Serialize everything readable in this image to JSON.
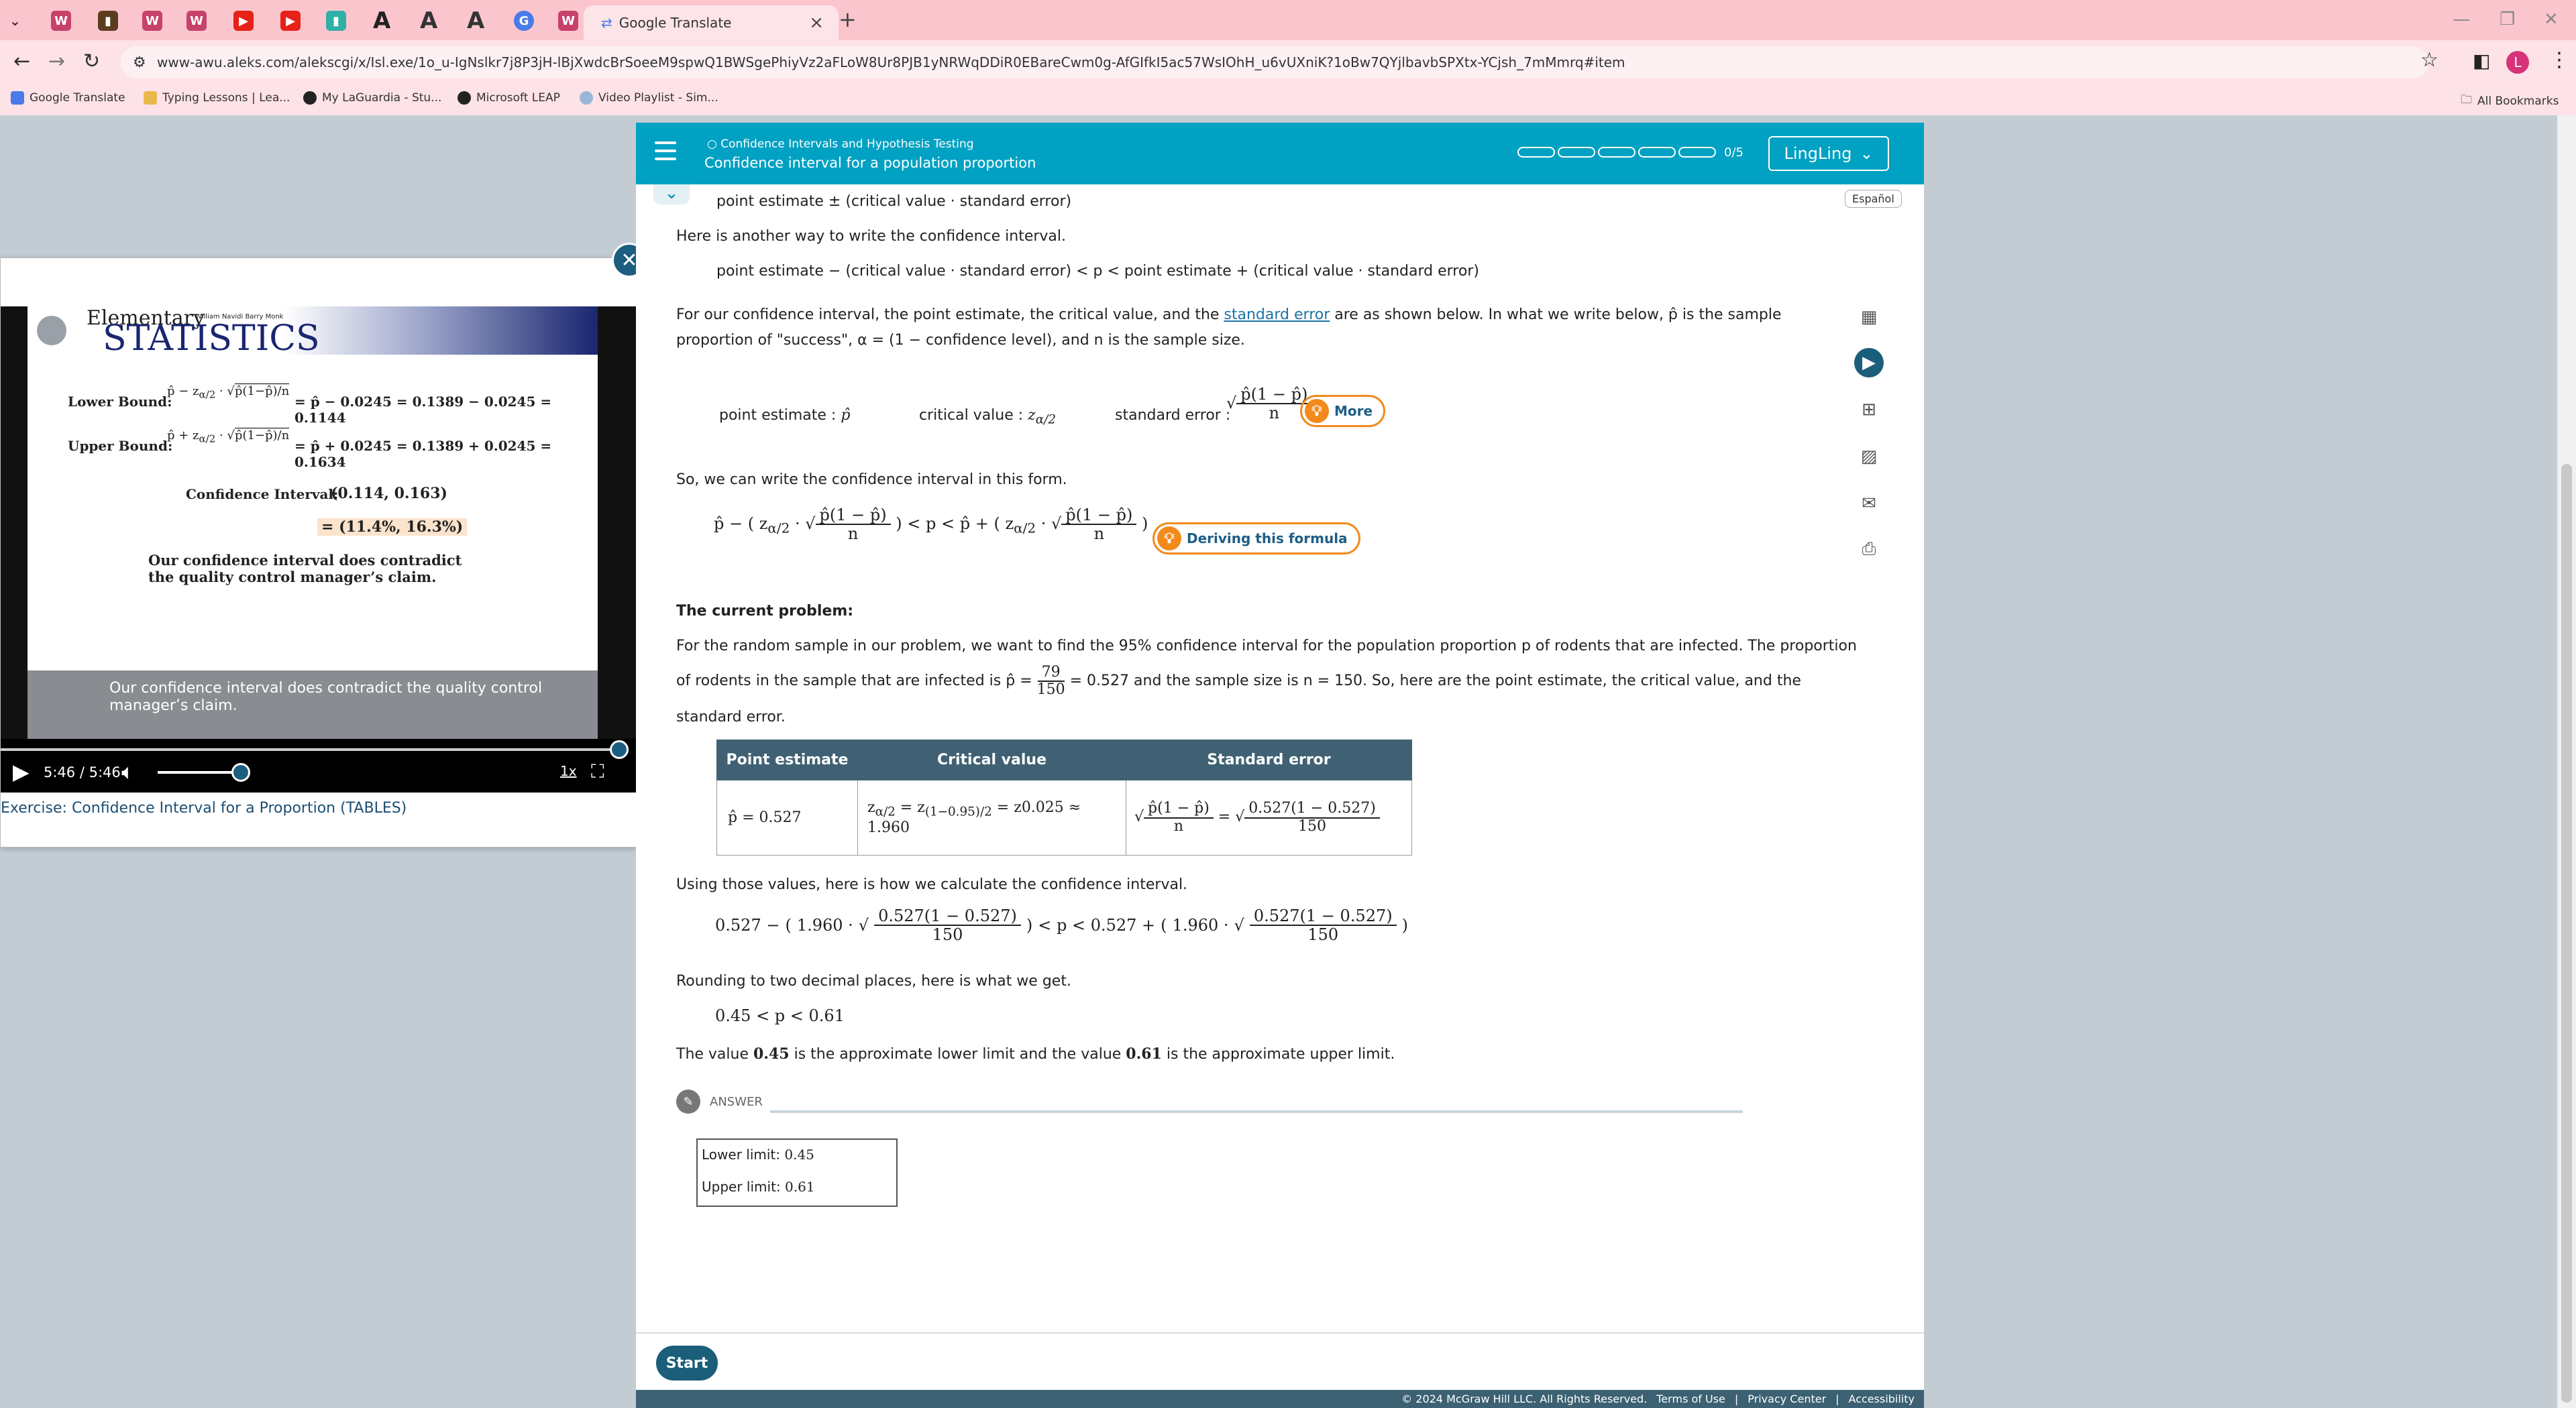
{
  "browser": {
    "active_tab_title": "Google Translate",
    "url": "www-awu.aleks.com/alekscgi/x/Isl.exe/1o_u-IgNslkr7j8P3jH-lBjXwdcBrSoeeM9spwQ1BWSgePhiyVz2aFLoW8Ur8PJB1yNRWqDDiR0EBareCwm0g-AfGIfkI5ac57WsIOhH_u6vUXniK?1oBw7QYjlbavbSPXtx-YCjsh_7mMmrq#item",
    "bookmarks": [
      "Google Translate",
      "Typing Lessons | Lea...",
      "My LaGuardia - Stu...",
      "Microsoft LEAP",
      "Video Playlist - Sim..."
    ],
    "all_bookmarks": "All Bookmarks",
    "profile_initial": "L"
  },
  "video": {
    "slide_title_small": "Elementary",
    "slide_title_big": "STATISTICS",
    "slide_authors": "William Navidi   Barry Monk",
    "lower_bound_label": "Lower Bound:",
    "lower_bound_eq": "= p̂ − 0.0245 = 0.1389 − 0.0245 = 0.1144",
    "upper_bound_label": "Upper Bound:",
    "upper_bound_eq": "= p̂ + 0.0245 = 0.1389 + 0.0245 = 0.1634",
    "ci_label": "Confidence Interval:",
    "ci_value": "(0.114, 0.163)",
    "ci_percent": "= (11.4%, 16.3%)",
    "slide_conclusion": "Our confidence interval does contradict the quality control manager’s claim.",
    "caption": "Our confidence interval does contradict the quality control manager’s claim.",
    "time": "5:46 / 5:46",
    "speed": "1x",
    "title": "Exercise: Confidence Interval for a Proportion (TABLES)"
  },
  "aleks": {
    "topic_category": "Confidence Intervals and Hypothesis Testing",
    "topic_title": "Confidence interval for a population proportion",
    "progress_text": "0/5",
    "user_name": "LingLing",
    "espanol": "Español",
    "line1": "point estimate ± (critical value · standard error)",
    "line2": "Here is another way to write the confidence interval.",
    "line3": "point estimate − (critical value · standard error) < p < point estimate + (critical value · standard error)",
    "para1a": "For our confidence interval, the point estimate, the critical value, and the ",
    "para1_link": "standard error",
    "para1b": " are as shown below. In what we write below, p̂ is the sample",
    "para1c": "proportion of \"success\", α = (1 − confidence level), and n is the sample size.",
    "pe_label": "point estimate :",
    "cv_label": "critical value :",
    "se_label": "standard error :",
    "more_btn": "More",
    "line_form": "So, we can write the confidence interval in this form.",
    "deriving_btn": "Deriving this formula",
    "current_problem": "The current problem:",
    "prob1": "For the random sample in our problem, we want to find the 95% confidence interval for the population proportion p of rodents that are infected. The proportion",
    "prob2a": "of rodents in the sample that are infected is p̂ =",
    "prob2_num": "79",
    "prob2_den": "150",
    "prob2b": "= 0.527 and the sample size is n = 150. So, here are the point estimate, the critical value, and the",
    "prob3": "standard error.",
    "table_headers": [
      "Point estimate",
      "Critical value",
      "Standard error"
    ],
    "table_pe": "p̂ = 0.527",
    "table_cv_result": "= z0.025 ≈ 1.960",
    "table_se_value": "0.527(1 − 0.527)",
    "table_se_den": "150",
    "using": "Using those values, here is how we calculate the confidence interval.",
    "calc_left": "0.527 −",
    "calc_z": "1.960 ·",
    "calc_num": "0.527(1 − 0.527)",
    "calc_den": "150",
    "calc_mid": "< p < 0.527 +",
    "rounding": "Rounding to two decimal places, here is what we get.",
    "result": "0.45 < p < 0.61",
    "final_a": "The value ",
    "final_v1": "0.45",
    "final_b": " is the approximate lower limit and the value ",
    "final_v2": "0.61",
    "final_c": " is the approximate upper limit.",
    "answer_label": "ANSWER",
    "lower_label": "Lower limit:",
    "lower_value": "0.45",
    "upper_label": "Upper limit:",
    "upper_value": "0.61",
    "start_btn": "Start",
    "footer": [
      "© 2024 McGraw Hill LLC. All Rights Reserved.",
      "Terms of Use",
      "Privacy Center",
      "Accessibility"
    ]
  }
}
